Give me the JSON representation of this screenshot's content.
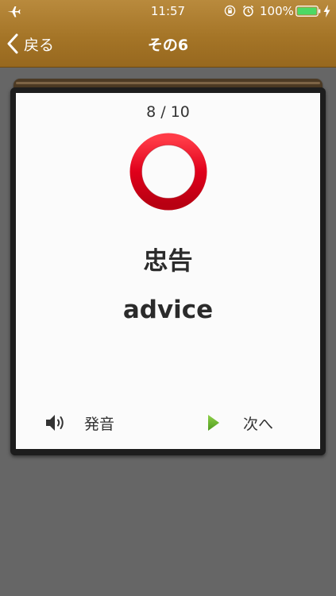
{
  "status_bar": {
    "time": "11:57",
    "battery_percent": "100%",
    "icons": [
      "airplane-icon",
      "rotation-lock-icon",
      "alarm-icon",
      "battery-icon",
      "charging-bolt-icon"
    ]
  },
  "nav": {
    "back_label": "戻る",
    "title": "その6"
  },
  "card": {
    "progress": "8 / 10",
    "result_icon": "correct-circle-icon",
    "word_japanese": "忠告",
    "word_english": "advice",
    "pronounce_label": "発音",
    "next_label": "次へ"
  },
  "colors": {
    "nav_bar": "#a57527",
    "background": "#666666",
    "card_frame": "#1d1d1d",
    "correct_mark": "#e0001b",
    "next_arrow": "#6fb52c",
    "battery": "#4cd964"
  }
}
